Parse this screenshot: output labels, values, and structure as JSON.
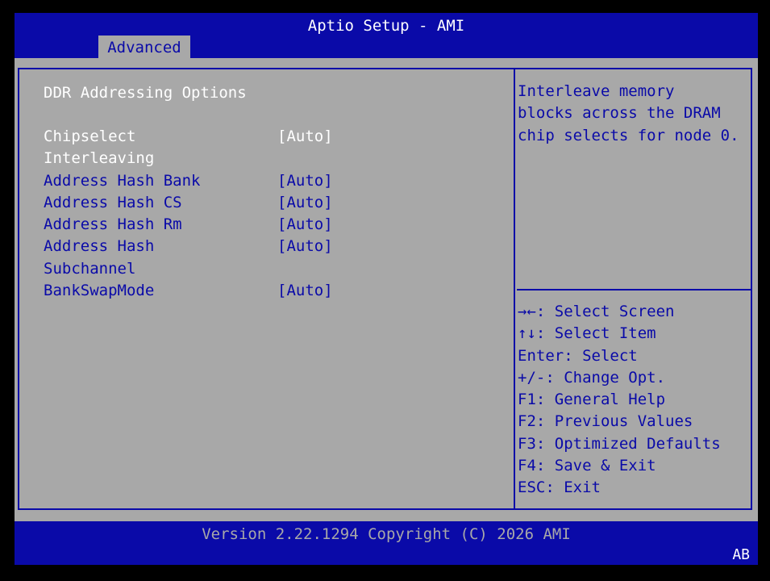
{
  "header": {
    "title": "Aptio Setup - AMI",
    "tab": "Advanced"
  },
  "section_title": "DDR Addressing Options",
  "options": [
    {
      "label": "Chipselect\nInterleaving",
      "value": "[Auto]",
      "selected": true
    },
    {
      "label": "Address Hash Bank",
      "value": "[Auto]",
      "selected": false
    },
    {
      "label": "Address Hash CS",
      "value": "[Auto]",
      "selected": false
    },
    {
      "label": "Address Hash Rm",
      "value": "[Auto]",
      "selected": false
    },
    {
      "label": "Address Hash\nSubchannel",
      "value": "[Auto]",
      "selected": false
    },
    {
      "label": "BankSwapMode",
      "value": "[Auto]",
      "selected": false
    }
  ],
  "help": {
    "lines": [
      "Interleave memory",
      "blocks across the DRAM",
      "chip selects for node 0."
    ]
  },
  "keys": [
    "→←: Select Screen",
    "↑↓: Select Item",
    "Enter: Select",
    "+/-: Change Opt.",
    "F1: General Help",
    "F2: Previous Values",
    "F3: Optimized Defaults",
    "F4: Save & Exit",
    "ESC: Exit"
  ],
  "footer": {
    "version": "Version 2.22.1294 Copyright (C) 2026 AMI",
    "badge": "AB"
  },
  "colors": {
    "blue": "#0a0aa8",
    "gray": "#a8a8a8",
    "white": "#ffffff",
    "black": "#000000"
  }
}
